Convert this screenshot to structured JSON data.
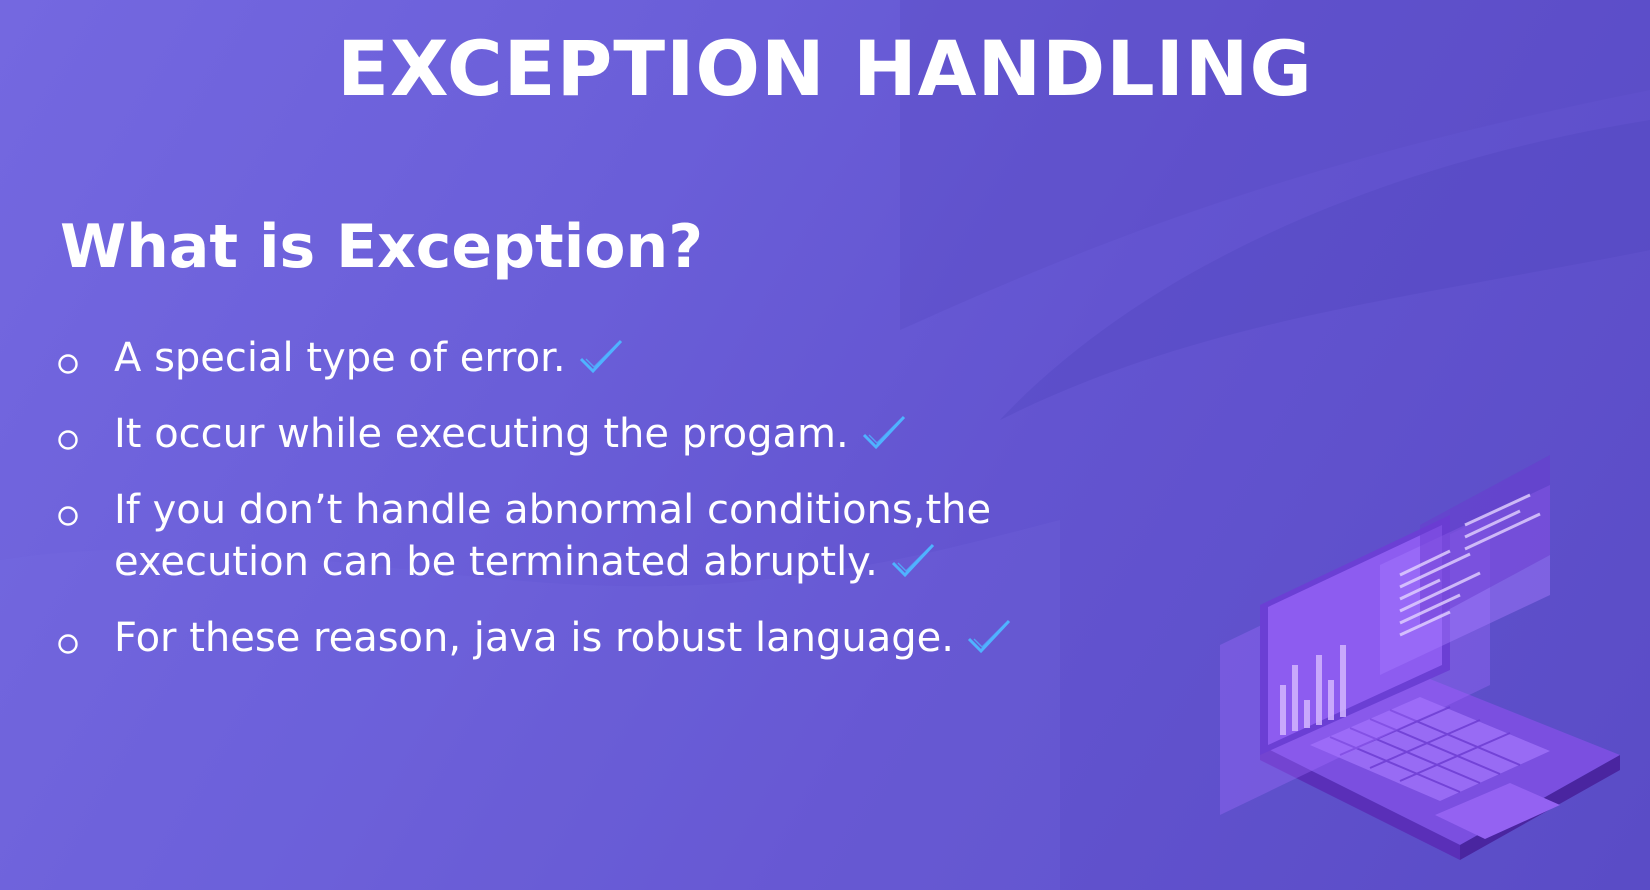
{
  "slide": {
    "title": "EXCEPTION HANDLING",
    "heading": "What is Exception?",
    "bullets": [
      {
        "text": "A special type of error."
      },
      {
        "text": "It occur while executing the progam."
      },
      {
        "text": "If you don’t handle abnormal conditions,the\nexecution can be terminated abruptly."
      },
      {
        "text": "For these reason, java is robust language."
      }
    ]
  },
  "icons": {
    "bullet_marker": "hollow-circle-icon",
    "check": "checkmark-icon",
    "illustration": "laptop-illustration-icon"
  },
  "colors": {
    "background": "#6a5ed8",
    "text": "#ffffff",
    "check": "#4fb3ff",
    "laptop": "#8a4fe6"
  }
}
